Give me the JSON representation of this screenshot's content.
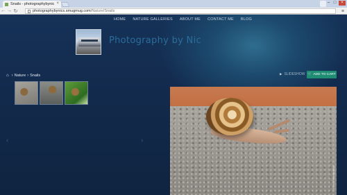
{
  "browser": {
    "tab_title": "Snails - photographybynic",
    "close_glyph": "×",
    "url_host": "photographybynics.smugmug.com",
    "url_path": "/Nature/Snails",
    "back_glyph": "←",
    "forward_glyph": "→",
    "reload_glyph": "↻",
    "menu_glyph": "≡",
    "min_glyph": "–",
    "max_glyph": "□"
  },
  "site": {
    "nav": [
      "HOME",
      "NATURE GALLERIES",
      "ABOUT ME",
      "CONTACT ME",
      "BLOG"
    ],
    "title": "Photography by Nic"
  },
  "breadcrumb": {
    "home_glyph": "⌂",
    "sep": "›",
    "items": [
      "Nature",
      "Snails"
    ]
  },
  "actions": {
    "slideshow_glyph": "▶",
    "slideshow_label": "SLIDESHOW",
    "cart_glyph": "🛒",
    "cart_label": "ADD TO CART"
  },
  "gallery": {
    "prev_glyph": "‹",
    "next_glyph": "›",
    "watermark": "© Nic Photography"
  }
}
